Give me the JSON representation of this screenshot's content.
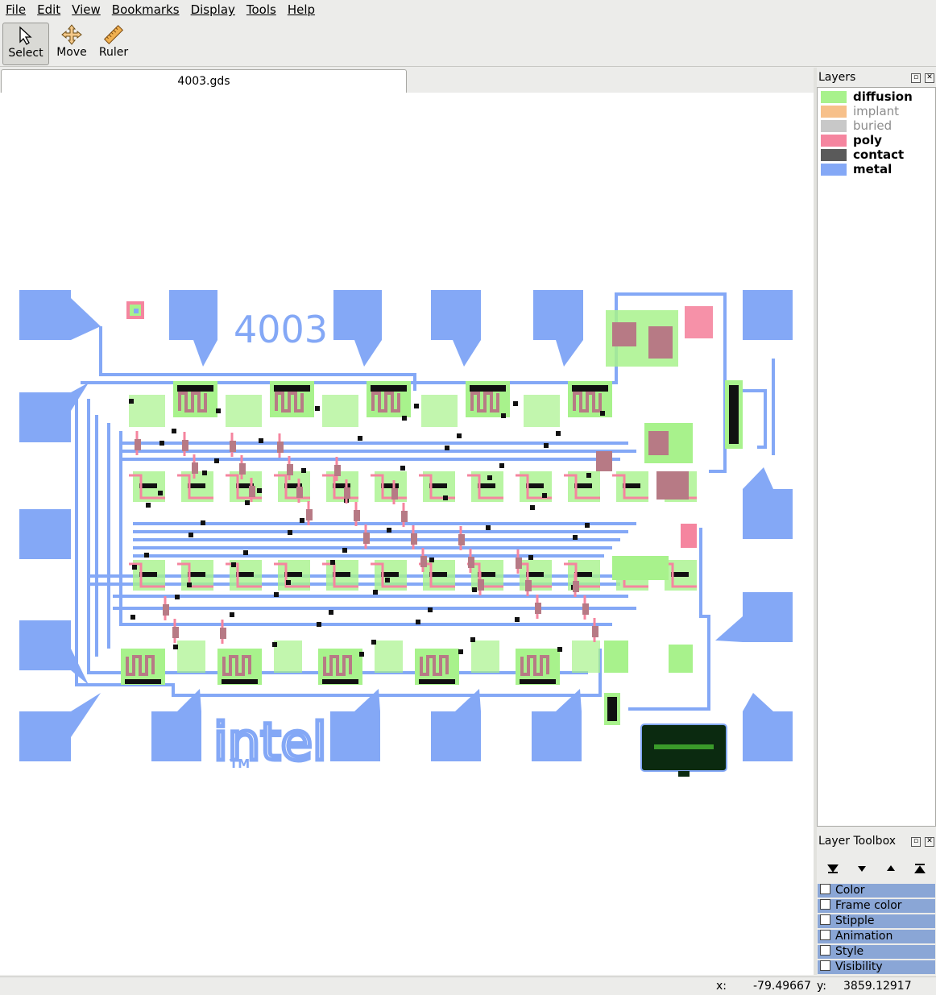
{
  "menu": [
    "File",
    "Edit",
    "View",
    "Bookmarks",
    "Display",
    "Tools",
    "Help"
  ],
  "toolbar": {
    "select": "Select",
    "move": "Move",
    "ruler": "Ruler"
  },
  "tab": {
    "title": "4003.gds"
  },
  "chip": {
    "part_number": "4003",
    "logo": "intel",
    "trademark": "TM"
  },
  "layers": {
    "title": "Layers",
    "items": [
      {
        "name": "diffusion",
        "color": "#a8f28c",
        "visible": true
      },
      {
        "name": "implant",
        "color": "#f7c08a",
        "visible": false
      },
      {
        "name": "buried",
        "color": "#c8c8c8",
        "visible": false
      },
      {
        "name": "poly",
        "color": "#f5859f",
        "visible": true
      },
      {
        "name": "contact",
        "color": "#5a5a5a",
        "visible": true
      },
      {
        "name": "metal",
        "color": "#84a8f6",
        "visible": true
      }
    ]
  },
  "layer_toolbox": {
    "title": "Layer Toolbox",
    "options": [
      "Color",
      "Frame color",
      "Stipple",
      "Animation",
      "Style",
      "Visibility"
    ]
  },
  "status": {
    "x_label": "x:",
    "x_value": "-79.49667",
    "y_label": "y:",
    "y_value": "3859.12917"
  },
  "icons": [
    "select-arrow-icon",
    "move-icon",
    "ruler-icon",
    "float-icon",
    "close-icon",
    "move-bottom-icon",
    "move-down-icon",
    "move-up-icon",
    "move-top-icon"
  ]
}
